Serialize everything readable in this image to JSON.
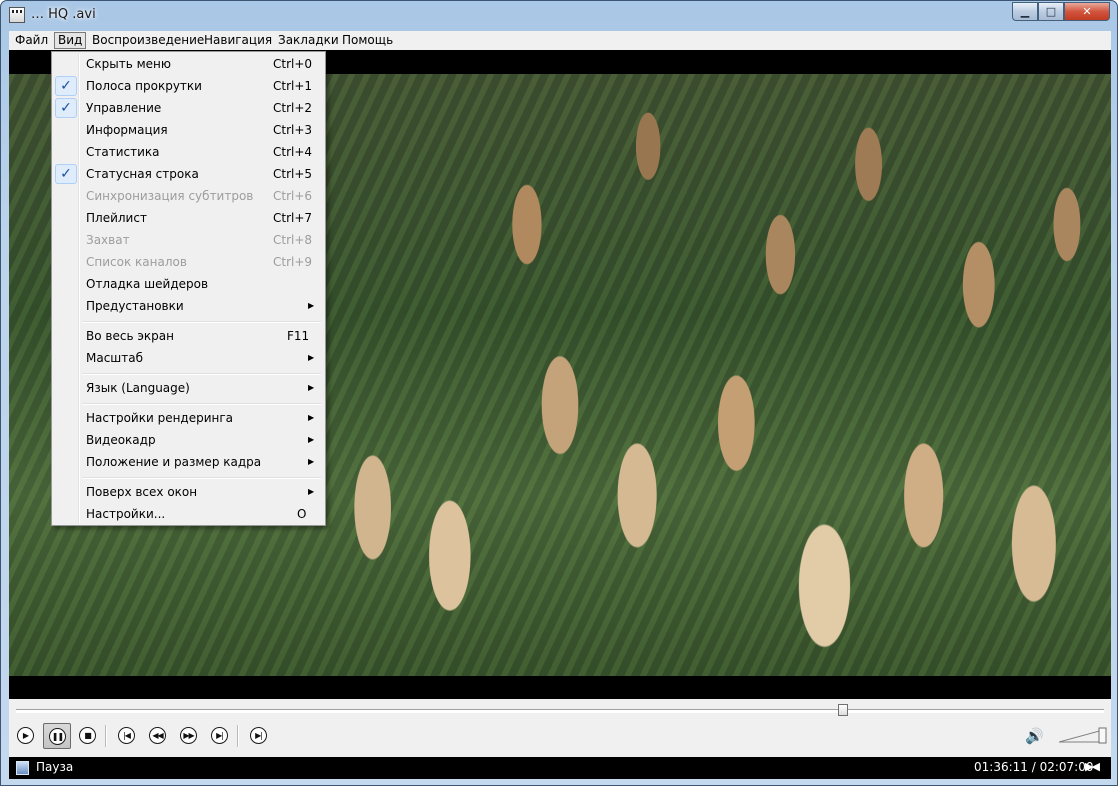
{
  "window": {
    "title": "…  HQ  .avi",
    "min_glyph": "▁",
    "max_glyph": "□",
    "close_glyph": "✕"
  },
  "menubar": {
    "items": [
      "Файл",
      "Вид",
      "Воспроизведение",
      "Навигация",
      "Закладки",
      "Помощь"
    ]
  },
  "view_menu": {
    "checkmark": "✓",
    "submenu_arrow": "▶",
    "items": [
      {
        "label": "Скрыть меню",
        "shortcut": "Ctrl+0",
        "checked": false,
        "enabled": true
      },
      {
        "label": "Полоса прокрутки",
        "shortcut": "Ctrl+1",
        "checked": true,
        "enabled": true
      },
      {
        "label": "Управление",
        "shortcut": "Ctrl+2",
        "checked": true,
        "enabled": true
      },
      {
        "label": "Информация",
        "shortcut": "Ctrl+3",
        "checked": false,
        "enabled": true
      },
      {
        "label": "Статистика",
        "shortcut": "Ctrl+4",
        "checked": false,
        "enabled": true
      },
      {
        "label": "Статусная строка",
        "shortcut": "Ctrl+5",
        "checked": true,
        "enabled": true
      },
      {
        "label": "Синхронизация субтитров",
        "shortcut": "Ctrl+6",
        "checked": false,
        "enabled": false
      },
      {
        "label": "Плейлист",
        "shortcut": "Ctrl+7",
        "checked": false,
        "enabled": true
      },
      {
        "label": "Захват",
        "shortcut": "Ctrl+8",
        "checked": false,
        "enabled": false
      },
      {
        "label": "Список каналов",
        "shortcut": "Ctrl+9",
        "checked": false,
        "enabled": false
      },
      {
        "label": "Отладка шейдеров",
        "shortcut": "",
        "checked": false,
        "enabled": true
      },
      {
        "label": "Предустановки",
        "shortcut": "",
        "submenu": true,
        "enabled": true
      },
      {
        "label": "Во весь экран",
        "shortcut": "F11",
        "enabled": true
      },
      {
        "label": "Масштаб",
        "shortcut": "",
        "submenu": true,
        "enabled": true
      },
      {
        "label": "Язык (Language)",
        "shortcut": "",
        "submenu": true,
        "enabled": true
      },
      {
        "label": "Настройки рендеринга",
        "shortcut": "",
        "submenu": true,
        "enabled": true
      },
      {
        "label": "Видеокадр",
        "shortcut": "",
        "submenu": true,
        "enabled": true
      },
      {
        "label": "Положение и размер кадра",
        "shortcut": "",
        "submenu": true,
        "enabled": true
      },
      {
        "label": "Поверх всех окон",
        "shortcut": "",
        "submenu": true,
        "enabled": true
      },
      {
        "label": "Настройки...",
        "shortcut": "O",
        "enabled": true
      }
    ]
  },
  "controls": {
    "seek_fraction": 0.76,
    "volume_fraction": 1.0,
    "buttons": {
      "play": "▶",
      "pause": "❚❚",
      "stop": "■",
      "prev": "|◀",
      "rewind": "◀◀",
      "forward": "▶▶",
      "next": "▶|",
      "frame_step": "▶|"
    },
    "volume_icon": "🔊"
  },
  "status": {
    "state": "Пауза",
    "time": "01:36:11 / 02:07:00",
    "aspect_icon": "▶◀"
  }
}
